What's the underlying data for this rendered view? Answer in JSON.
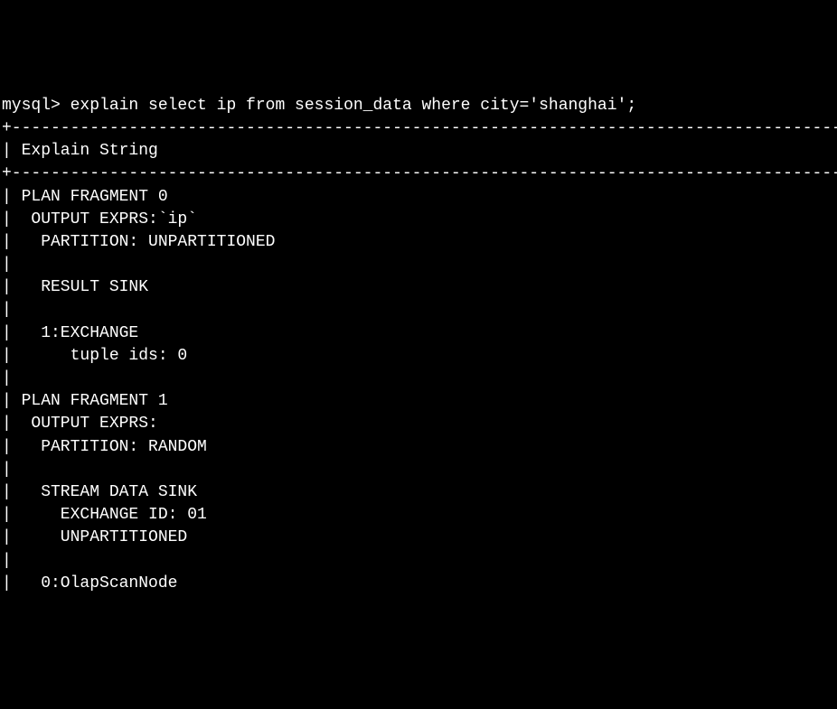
{
  "prompt": "mysql>",
  "command": " explain select ip from session_data where city='shanghai';",
  "separator1": "+----------------------------------------------------------------------------------------",
  "header": "| Explain String",
  "separator2": "+----------------------------------------------------------------------------------------",
  "lines": [
    "| PLAN FRAGMENT 0",
    "|  OUTPUT EXPRS:`ip`",
    "|   PARTITION: UNPARTITIONED",
    "|",
    "|   RESULT SINK",
    "|",
    "|   1:EXCHANGE",
    "|      tuple ids: 0",
    "|",
    "| PLAN FRAGMENT 1",
    "|  OUTPUT EXPRS:",
    "|   PARTITION: RANDOM",
    "|",
    "|   STREAM DATA SINK",
    "|     EXCHANGE ID: 01",
    "|     UNPARTITIONED",
    "|",
    "|   0:OlapScanNode"
  ]
}
